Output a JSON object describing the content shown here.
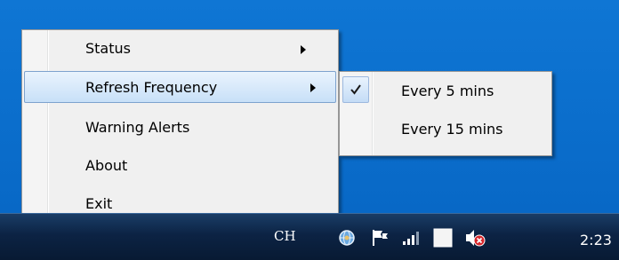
{
  "context_menu": {
    "items": [
      {
        "label": "Status",
        "has_submenu": true
      },
      {
        "label": "Refresh Frequency",
        "has_submenu": true,
        "highlighted": true
      },
      {
        "label": "Warning Alerts",
        "has_submenu": false
      },
      {
        "label": "About",
        "has_submenu": false
      },
      {
        "label": "Exit",
        "has_submenu": false
      }
    ]
  },
  "submenu": {
    "items": [
      {
        "label": "Every 5 mins",
        "checked": true
      },
      {
        "label": "Every 15 mins",
        "checked": false
      }
    ]
  },
  "taskbar": {
    "language": "CH",
    "clock": "2:23",
    "icons": [
      "globe-icon",
      "flag-icon",
      "signal-bars-icon",
      "blank-app-icon",
      "muted-speaker-icon"
    ]
  },
  "colors": {
    "desktop": "#0b6fce",
    "taskbar": "#0c2344",
    "menu_background": "#f0f0f0",
    "highlight_border": "#7da2ce"
  }
}
